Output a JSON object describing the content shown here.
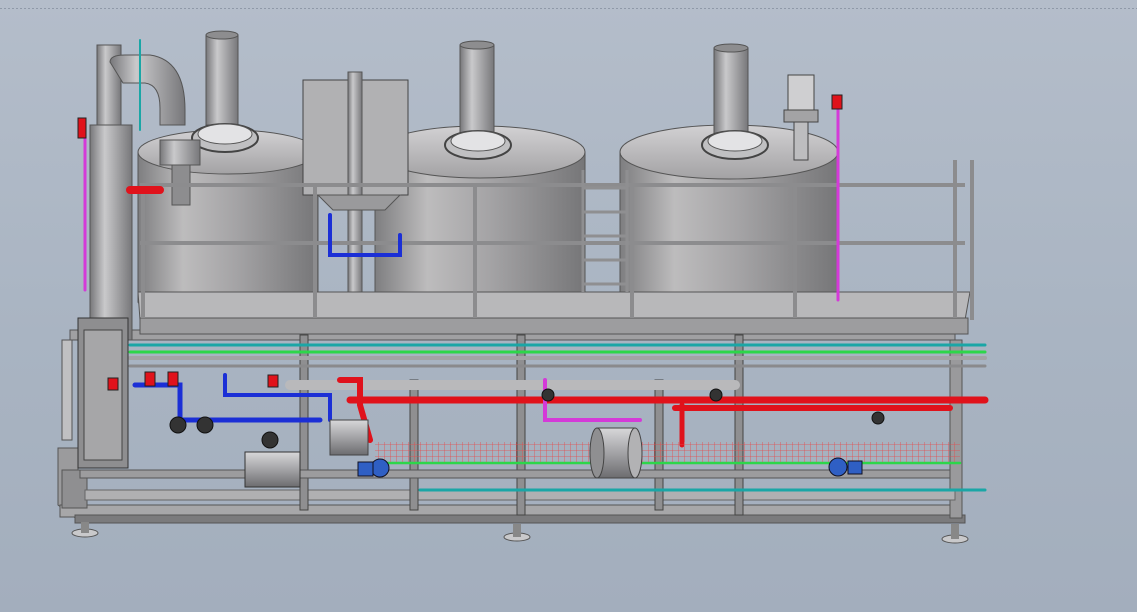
{
  "viewport": {
    "background": "#aab4c2"
  },
  "colors": {
    "steel": "#a9a9a9",
    "steel_dark": "#6f6f6f",
    "steel_light": "#d6d6d6",
    "pipe_blue": "#1b2fd6",
    "pipe_red": "#e0121b",
    "pipe_cyan": "#1aa6a6",
    "pipe_green": "#2dd64a",
    "pipe_magenta": "#d43ad8",
    "heat_trace": "#e63a3a",
    "valve_blue": "#2f5fc4",
    "frame": "#8c8c8c"
  },
  "parts": [
    "tank-1",
    "tank-2",
    "tank-3",
    "chimney-1",
    "chimney-2",
    "chimney-3",
    "manway-1",
    "manway-2",
    "manway-3",
    "cyclone-column",
    "control-cabinet",
    "platform-railing",
    "access-ladder",
    "pipe-rack",
    "skid-base",
    "pump-1",
    "pump-2",
    "heat-exchanger",
    "horizontal-vessel",
    "sight-glass"
  ]
}
